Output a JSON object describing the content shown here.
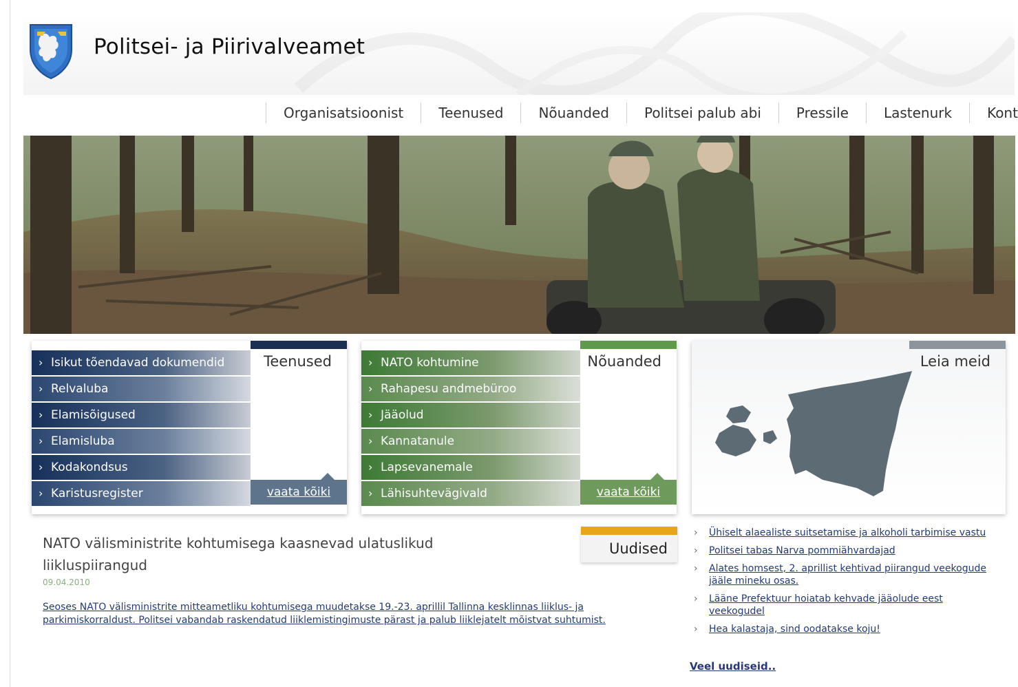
{
  "header": {
    "site_title": "Politsei- ja Piirivalveamet"
  },
  "nav": [
    {
      "label": "Organisatsioonist"
    },
    {
      "label": "Teenused"
    },
    {
      "label": "Nõuanded"
    },
    {
      "label": "Politsei palub abi"
    },
    {
      "label": "Pressile"
    },
    {
      "label": "Lastenurk"
    },
    {
      "label": "Kontakt"
    }
  ],
  "panels": {
    "services": {
      "title": "Teenused",
      "accent": "#1c2f52",
      "items": [
        {
          "label": "Isikut tõendavad dokumendid"
        },
        {
          "label": "Relvaluba"
        },
        {
          "label": "Elamisõigused"
        },
        {
          "label": "Elamisluba"
        },
        {
          "label": "Kodakondsus"
        },
        {
          "label": "Karistusregister"
        }
      ],
      "see_all": "vaata kõiki"
    },
    "advice": {
      "title": "Nõuanded",
      "accent": "#5f9a4c",
      "items": [
        {
          "label": "NATO kohtumine"
        },
        {
          "label": "Rahapesu andmebüroo"
        },
        {
          "label": "Jääolud"
        },
        {
          "label": "Kannatanule"
        },
        {
          "label": "Lapsevanemale"
        },
        {
          "label": "Lähisuhtevägivald"
        }
      ],
      "see_all": "vaata kõiki"
    },
    "find_us": {
      "title": "Leia meid",
      "accent": "#8d959c",
      "map_color": "#5d6b74"
    }
  },
  "news": {
    "tab_label": "Uudised",
    "tab_accent": "#e8a51c",
    "headline": "NATO välisministrite kohtumisega kaasnevad ulatuslikud liikluspiirangud",
    "date": "09.04.2010",
    "body": "Seoses NATO välisministrite mitteametliku kohtumisega muudetakse 19.-23. aprillil Tallinna kesklinnas liiklus- ja parkimiskorraldust. Politsei vabandab raskendatud liiklemistingimuste pärast ja palub liiklejatelt mõistvat suhtumist."
  },
  "side_news": {
    "items": [
      {
        "label": "Ühiselt alaealiste suitsetamise ja alkoholi tarbimise vastu"
      },
      {
        "label": "Politsei tabas Narva pommiähvardajad"
      },
      {
        "label": "Alates homsest, 2. aprillist kehtivad piirangud veekogude jääle mineku osas."
      },
      {
        "label": "Lääne Prefektuur hoiatab kehvade jääolude eest veekogudel"
      },
      {
        "label": "Hea kalastaja, sind oodatakse koju!"
      }
    ],
    "more": "Veel uudiseid.."
  }
}
